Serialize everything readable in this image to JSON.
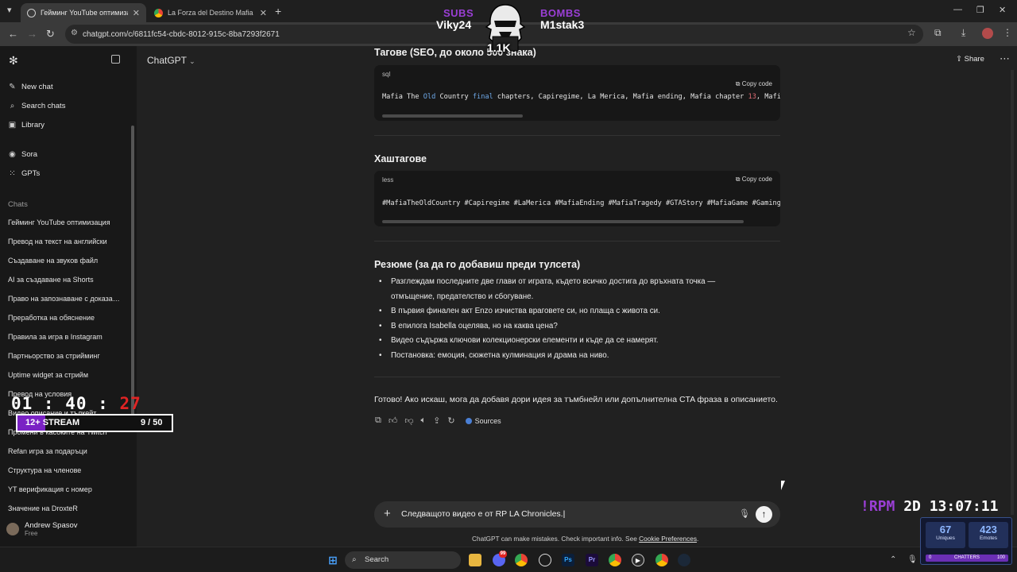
{
  "browser": {
    "tabs": [
      {
        "title": "Гейминг YouTube оптимизация",
        "active": true
      },
      {
        "title": "La Forza del Destino Mafia the",
        "active": false
      }
    ],
    "url": "chatgpt.com/c/6811fc54-cbdc-8012-915c-8ba7293f2671"
  },
  "sidebar": {
    "items": [
      {
        "label": "New chat",
        "icon": "edit-icon"
      },
      {
        "label": "Search chats",
        "icon": "search-icon"
      },
      {
        "label": "Library",
        "icon": "library-icon"
      },
      {
        "label": "Sora",
        "icon": "sora-icon"
      },
      {
        "label": "GPTs",
        "icon": "grid-icon"
      }
    ],
    "section_label": "Chats",
    "chats": [
      "Гейминг YouTube оптимизация",
      "Превод на текст на английски",
      "Създаване на звуков файл",
      "AI за създаване на Shorts",
      "Право на запознаване с доказа…",
      "Преработка на обяснение",
      "Правила за игра в Instagram",
      "Партньорство за стрийминг",
      "Uptime widget за стрийм",
      "Превод на условия",
      "Видео описание и тълкейт",
      "Промени в касоките на Twitch",
      "Refan игра за подаръци",
      "Структура на членове",
      "YT верификация с номер",
      "Значение на DroxteR"
    ],
    "user": {
      "name": "Andrew Spasov",
      "plan": "Free"
    }
  },
  "header": {
    "title": "ChatGPT",
    "share_label": "Share"
  },
  "content": {
    "section1_title": "Тагове (SEO, до около 500 знака)",
    "code1": {
      "lang": "sql",
      "copy_label": "Copy code",
      "tokens": [
        "Mafia The ",
        "Old",
        " Country ",
        "final",
        " chapters, Capiregime, La Merica, Mafia ending, Mafia chapter ",
        "13",
        ", Mafia"
      ]
    },
    "section2_title": "Хаштагове",
    "code2": {
      "lang": "less",
      "copy_label": "Copy code",
      "text": "#MafiaTheOldCountry #Capiregime #LaMerica #MafiaEnding #MafiaTragedy #GTAStory #MafiaGame #GamingR"
    },
    "section3_title": "Резюме (за да го добавиш преди тулсета)",
    "bullets": [
      "Разглеждам последните две глави от играта, където всичко достига до връхната точка — отмъщение, предателство и сбогуване.",
      "В първия финален акт Enzo изчиства враговете си, но плаща с живота си.",
      "В епилога Isabella оцелява, но на каква цена?",
      "Видео съдържа ключови колекционерски елементи и къде да се намерят.",
      "Постановка: емоция, сюжетна кулминация и драма на ниво."
    ],
    "closing": "Готово! Ако искаш, мога да добавя дори идея за тъмбнейл или допълнителна CTA фраза в описанието.",
    "sources_label": "Sources"
  },
  "composer": {
    "value": "Следващото видео е от RP LA Chronicles.",
    "disclaimer_prefix": "ChatGPT can make mistakes. Check important info. See ",
    "disclaimer_link": "Cookie Preferences",
    "disclaimer_suffix": "."
  },
  "taskbar": {
    "search_label": "Search",
    "discord_badge": "99"
  },
  "overlays": {
    "subs_label": "SUBS",
    "subs_name": "Viky24",
    "bombs_label": "BOMBS",
    "bombs_name": "M1stak3",
    "mascot_count": "1.1K",
    "timer_hm": "01 : 40 : ",
    "timer_sec": "27",
    "goal_label": "12+ STREAM",
    "goal_count": "9 / 50",
    "goal_progress": 0.18,
    "rpm_cmd": "!RPM",
    "rpm_time": " 2D 13:07:11",
    "uniques_value": "67",
    "uniques_label": "Uniques",
    "emotes_value": "423",
    "emotes_label": "Emotes",
    "chatters_label": "CHATTERS",
    "chatters_min": "0",
    "chatters_max": "100"
  },
  "colors": {
    "accent_purple": "#9b3fd6",
    "background": "#212121",
    "sidebar": "#181818"
  }
}
